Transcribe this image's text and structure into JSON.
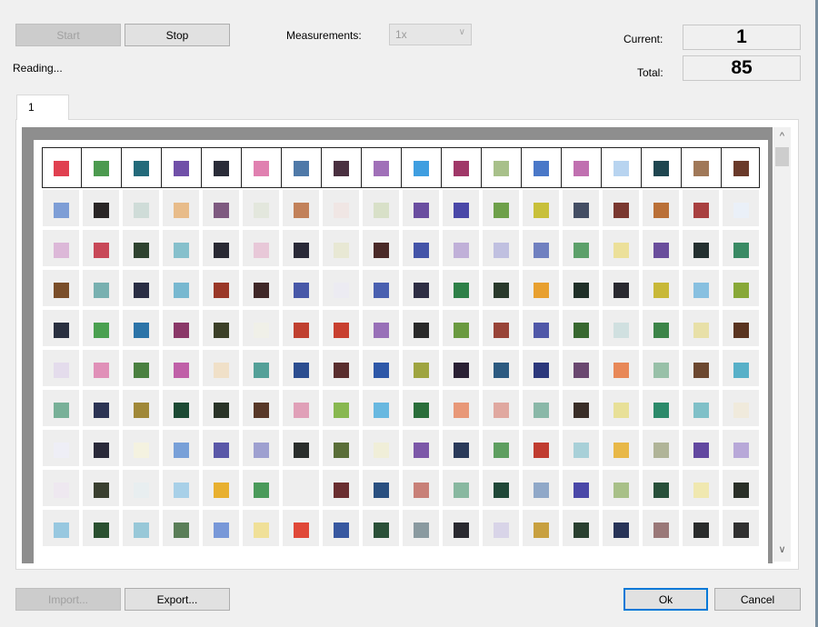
{
  "toolbar": {
    "start_label": "Start",
    "stop_label": "Stop",
    "measurements_label": "Measurements:",
    "measurements_value": "1x"
  },
  "status": {
    "reading_text": "Reading...",
    "current_label": "Current:",
    "current_value": "1",
    "total_label": "Total:",
    "total_value": "85"
  },
  "tabs": [
    {
      "label": "1"
    }
  ],
  "icons": {
    "scroll_up": "chevron-up-icon",
    "scroll_down": "chevron-down-icon",
    "combo_arrow": "chevron-down-icon"
  },
  "plate": {
    "header_row": [
      "#e04050",
      "#4c9a4f",
      "#236a7a",
      "#7050a8",
      "#2a2c38",
      "#e080b0",
      "#4f79a8",
      "#4a3040",
      "#a070b8",
      "#3f9ee0",
      "#a03868",
      "#a8c08a",
      "#4a78c8",
      "#c070b0",
      "#b8d4f0",
      "#1f4650",
      "#a07858",
      "#6a3a2a"
    ],
    "rows": [
      [
        "#7e9ed6",
        "#2a2626",
        "#cfdcd8",
        "#e8bc8a",
        "#7e5a80",
        "#e3e7dd",
        "#c2815a",
        "#f0e6e4",
        "#d8e0c8",
        "#6a4ea0",
        "#4a48a8",
        "#6ea04a",
        "#c8c03a",
        "#444e64",
        "#7a3830",
        "#ba7038",
        "#a84040",
        "#eaf0f8"
      ],
      [
        "#dcb8d8",
        "#c84858",
        "#2f4330",
        "#86c0cc",
        "#2a2a34",
        "#e8c8d8",
        "#2a2a38",
        "#e8e8d4",
        "#4a2a28",
        "#4454a8",
        "#c0b0d8",
        "#c0c0e0",
        "#7080c0",
        "#5ca06a",
        "#ece09a",
        "#6a4e9c",
        "#243030",
        "#3a8a64"
      ],
      [
        "#7a4e2a",
        "#78b0b0",
        "#2a2e44",
        "#78b8d0",
        "#9a3828",
        "#402828",
        "#4858a8",
        "#ecebf2",
        "#4a60b0",
        "#2e2e44",
        "#2e8048",
        "#2a3a2c",
        "#e8a030",
        "#203028",
        "#2a2a30",
        "#c8b838",
        "#88c0e0",
        "#88a838"
      ],
      [
        "#2a3040",
        "#4aa050",
        "#2c74a8",
        "#8a3868",
        "#3c4028",
        "#f0f0e8",
        "#c04030",
        "#c84030",
        "#9870b8",
        "#2a2a2a",
        "#6a9a40",
        "#984438",
        "#5058a8",
        "#386830",
        "#d0e0e0",
        "#3c8448",
        "#e8e0a8",
        "#5a3420"
      ],
      [
        "#e4dcec",
        "#e090b8",
        "#4a8040",
        "#c060a8",
        "#f0e0c8",
        "#54a098",
        "#2c4e90",
        "#5a2e2e",
        "#2e58a8",
        "#9ea440",
        "#2a2034",
        "#2c5a80",
        "#2c387c",
        "#6a4870",
        "#e88858",
        "#98c0a8",
        "#6c4830",
        "#58b0c8"
      ],
      [
        "#78b098",
        "#2c3454",
        "#a08838",
        "#1c4a34",
        "#2a3428",
        "#583828",
        "#e0a0b8",
        "#88b850",
        "#68b8e0",
        "#2a6e3a",
        "#e89878",
        "#e0a8a0",
        "#8ab8a8",
        "#3a2e28",
        "#e8e098",
        "#2c8a6a",
        "#80c0c8",
        "#f0eadc"
      ],
      [
        "#eeeef6",
        "#2a2a3a",
        "#f4f2e0",
        "#78a0d8",
        "#5a58a8",
        "#9ea0d0",
        "#2a2e2c",
        "#5a6e38",
        "#f0eed8",
        "#7c58a8",
        "#2a3a5a",
        "#5e9e60",
        "#c03c30",
        "#a8d0d8",
        "#e8b848",
        "#b0b498",
        "#6248a0",
        "#b8a8d8"
      ],
      [
        "#eee8f0",
        "#3a4030",
        "#e8eef0",
        "#a8d0e8",
        "#e8b030",
        "#4a9a5a",
        "#eeeeee",
        "#6a2e30",
        "#2a5080",
        "#c88078",
        "#88b8a0",
        "#204838",
        "#90a8c8",
        "#4a48a8",
        "#a8c088",
        "#28503a",
        "#f0e8b0",
        "#2a3028"
      ],
      [
        "#98c8e0",
        "#2a5030",
        "#98c8d8",
        "#5a7e58",
        "#7898d8",
        "#f0e098",
        "#e04838",
        "#3858a0",
        "#2a5038",
        "#8a9aa0",
        "#2a2a30",
        "#d8d4e8",
        "#c8a040",
        "#2a4030",
        "#283458",
        "#9a7878",
        "#2a2c2c",
        "#303030"
      ]
    ]
  }
}
